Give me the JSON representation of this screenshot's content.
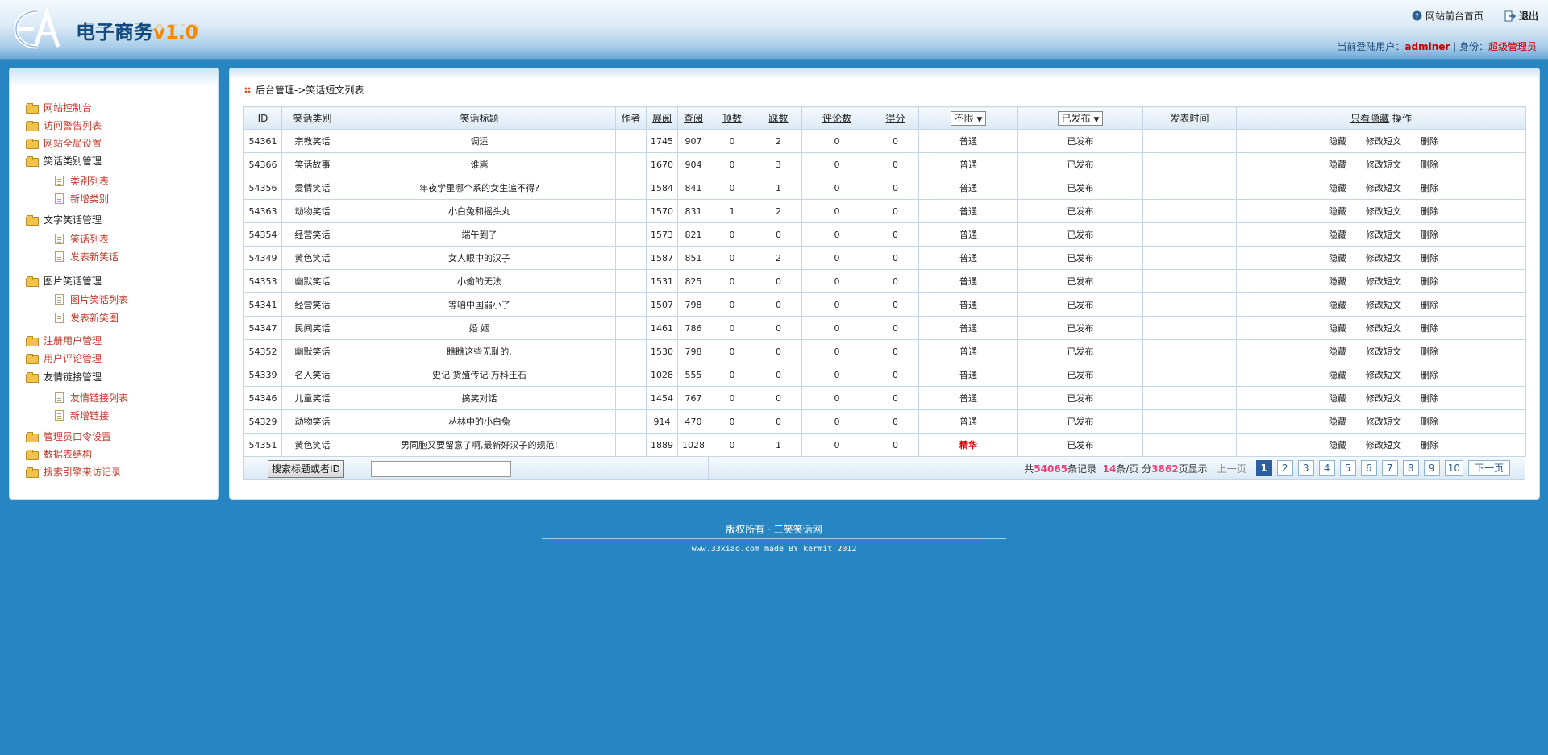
{
  "header": {
    "brand": "电子商务",
    "version": "v1.0",
    "front_link": "网站前台首页",
    "logout": "退出",
    "user_label": "当前登陆用户：",
    "user_name": "adminer",
    "sep": " | ",
    "role_label": "身份：",
    "role": "超级管理员"
  },
  "sidebar": {
    "items": [
      {
        "label": "网站控制台",
        "kind": "link"
      },
      {
        "label": "访问警告列表",
        "kind": "link"
      },
      {
        "label": "网站全局设置",
        "kind": "link"
      },
      {
        "label": "笑话类别管理",
        "kind": "group"
      },
      {
        "label": "类别列表",
        "kind": "sub"
      },
      {
        "label": "新增类别",
        "kind": "sub"
      },
      {
        "label": "文字笑话管理",
        "kind": "group"
      },
      {
        "label": "笑话列表",
        "kind": "sub"
      },
      {
        "label": "发表新笑话",
        "kind": "sub"
      },
      {
        "label": "图片笑话管理",
        "kind": "group"
      },
      {
        "label": "图片笑话列表",
        "kind": "sub"
      },
      {
        "label": "发表新笑图",
        "kind": "sub"
      },
      {
        "label": "注册用户管理",
        "kind": "link"
      },
      {
        "label": "用户评论管理",
        "kind": "link"
      },
      {
        "label": "友情链接管理",
        "kind": "group"
      },
      {
        "label": "友情链接列表",
        "kind": "sub"
      },
      {
        "label": "新增链接",
        "kind": "sub"
      },
      {
        "label": "管理员口令设置",
        "kind": "link"
      },
      {
        "label": "数据表结构",
        "kind": "link"
      },
      {
        "label": "搜索引擎来访记录",
        "kind": "link"
      }
    ]
  },
  "main": {
    "breadcrumb": "后台管理->笑话短文列表",
    "columns": {
      "id": "ID",
      "category": "笑话类别",
      "title": "笑话标题",
      "author": "作者",
      "views": "展阅",
      "reads": "查阅",
      "up": "顶数",
      "down": "踩数",
      "comments": "评论数",
      "score": "得分",
      "level_select": "不限",
      "status_select": "已发布",
      "publish_time": "发表时间",
      "hide_only": "只看隐藏",
      "ops": "操作"
    },
    "row_actions": {
      "hide": "隐藏",
      "edit": "修改短文",
      "delete": "删除"
    },
    "rows": [
      {
        "id": "54361",
        "category": "宗教笑话",
        "title": "调适",
        "author": "",
        "views": "1745",
        "reads": "907",
        "up": "0",
        "down": "2",
        "comments": "0",
        "score": "0",
        "level": "普通",
        "status": "已发布",
        "time": ""
      },
      {
        "id": "54366",
        "category": "笑话故事",
        "title": "谁嵩",
        "author": "",
        "views": "1670",
        "reads": "904",
        "up": "0",
        "down": "3",
        "comments": "0",
        "score": "0",
        "level": "普通",
        "status": "已发布",
        "time": ""
      },
      {
        "id": "54356",
        "category": "爱情笑话",
        "title": "年夜学里哪个系的女生追不得?",
        "author": "",
        "views": "1584",
        "reads": "841",
        "up": "0",
        "down": "1",
        "comments": "0",
        "score": "0",
        "level": "普通",
        "status": "已发布",
        "time": ""
      },
      {
        "id": "54363",
        "category": "动物笑话",
        "title": "小白兔和摇头丸",
        "author": "",
        "views": "1570",
        "reads": "831",
        "up": "1",
        "down": "2",
        "comments": "0",
        "score": "0",
        "level": "普通",
        "status": "已发布",
        "time": ""
      },
      {
        "id": "54354",
        "category": "经营笑话",
        "title": "端午到了",
        "author": "",
        "views": "1573",
        "reads": "821",
        "up": "0",
        "down": "0",
        "comments": "0",
        "score": "0",
        "level": "普通",
        "status": "已发布",
        "time": ""
      },
      {
        "id": "54349",
        "category": "黄色笑话",
        "title": "女人眼中的汉子",
        "author": "",
        "views": "1587",
        "reads": "851",
        "up": "0",
        "down": "2",
        "comments": "0",
        "score": "0",
        "level": "普通",
        "status": "已发布",
        "time": ""
      },
      {
        "id": "54353",
        "category": "幽默笑话",
        "title": "小偷的无法",
        "author": "",
        "views": "1531",
        "reads": "825",
        "up": "0",
        "down": "0",
        "comments": "0",
        "score": "0",
        "level": "普通",
        "status": "已发布",
        "time": ""
      },
      {
        "id": "54341",
        "category": "经营笑话",
        "title": "等咱中国弱小了",
        "author": "",
        "views": "1507",
        "reads": "798",
        "up": "0",
        "down": "0",
        "comments": "0",
        "score": "0",
        "level": "普通",
        "status": "已发布",
        "time": ""
      },
      {
        "id": "54347",
        "category": "民间笑话",
        "title": "婚 姻",
        "author": "",
        "views": "1461",
        "reads": "786",
        "up": "0",
        "down": "0",
        "comments": "0",
        "score": "0",
        "level": "普通",
        "status": "已发布",
        "time": ""
      },
      {
        "id": "54352",
        "category": "幽默笑话",
        "title": "瞧瞧这些无耻的.",
        "author": "",
        "views": "1530",
        "reads": "798",
        "up": "0",
        "down": "0",
        "comments": "0",
        "score": "0",
        "level": "普通",
        "status": "已发布",
        "time": ""
      },
      {
        "id": "54339",
        "category": "名人笑话",
        "title": "史记·货殖传记·万科王石",
        "author": "",
        "views": "1028",
        "reads": "555",
        "up": "0",
        "down": "0",
        "comments": "0",
        "score": "0",
        "level": "普通",
        "status": "已发布",
        "time": ""
      },
      {
        "id": "54346",
        "category": "儿童笑话",
        "title": "搞笑对话",
        "author": "",
        "views": "1454",
        "reads": "767",
        "up": "0",
        "down": "0",
        "comments": "0",
        "score": "0",
        "level": "普通",
        "status": "已发布",
        "time": ""
      },
      {
        "id": "54329",
        "category": "动物笑话",
        "title": "丛林中的小白兔",
        "author": "",
        "views": "914",
        "reads": "470",
        "up": "0",
        "down": "0",
        "comments": "0",
        "score": "0",
        "level": "普通",
        "status": "已发布",
        "time": ""
      },
      {
        "id": "54351",
        "category": "黄色笑话",
        "title": "男同胞又要留意了啊,最新好汉子的规范!",
        "author": "",
        "views": "1889",
        "reads": "1028",
        "up": "0",
        "down": "1",
        "comments": "0",
        "score": "0",
        "level": "精华",
        "status": "已发布",
        "time": ""
      }
    ],
    "search_button": "搜索标题或者ID",
    "search_value": "",
    "pager": {
      "total_prefix": "共",
      "total": "54065",
      "total_suffix": "条记录",
      "per_page": "14",
      "per_page_suffix": "条/页",
      "pages_prefix": "分",
      "pages": "3862",
      "pages_suffix": "页显示",
      "prev": "上一页",
      "page_numbers": [
        "1",
        "2",
        "3",
        "4",
        "5",
        "6",
        "7",
        "8",
        "9",
        "10"
      ],
      "current": "1",
      "next": "下一页"
    }
  },
  "footer": {
    "copyright": "版权所有 · 三笑笑话网",
    "made_by": "www.33xiao.com made BY kermit 2012"
  },
  "colors": {
    "page_bg": "#2785c2",
    "link_red": "#c0392b",
    "highlight_pink": "#e8447a",
    "current_page": "#2b5f9e"
  },
  "icons": [
    "logo-icon",
    "help-icon",
    "logout-icon",
    "folder-icon",
    "document-icon",
    "breadcrumb-icon",
    "dropdown-arrow-icon"
  ]
}
